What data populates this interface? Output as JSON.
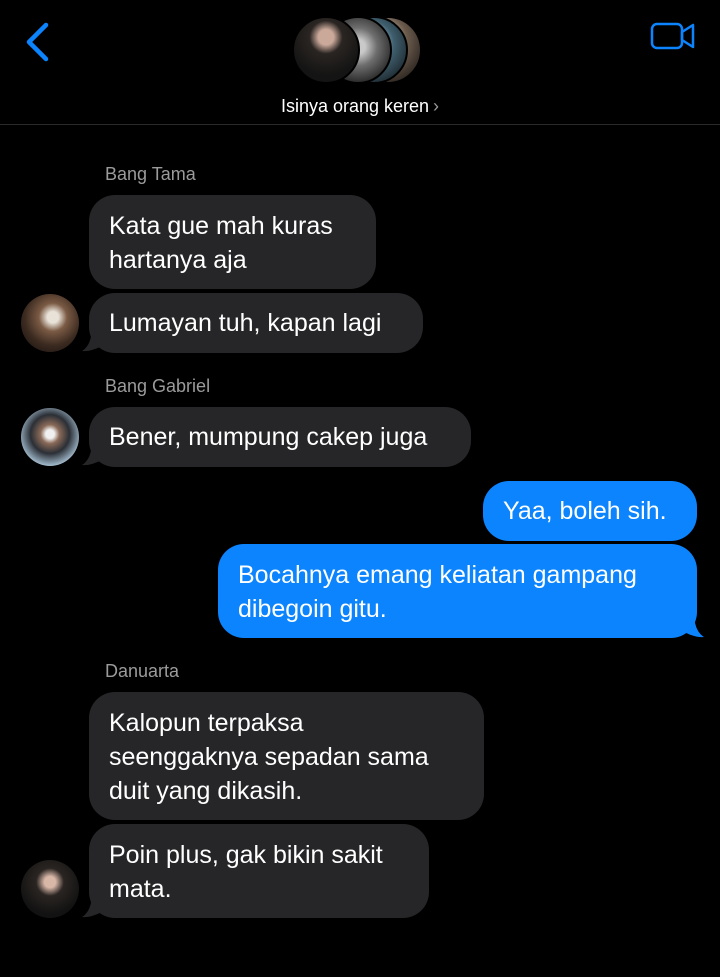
{
  "header": {
    "group_name": "Isinya orang keren",
    "chevron": "›",
    "back_icon": "chevron-left-icon",
    "video_icon": "video-camera-icon",
    "accent_color": "#0b84fe"
  },
  "messages": {
    "tama_name": "Bang Tama",
    "tama_1_line1": "Kata gue mah kuras",
    "tama_1_line2": "hartanya aja",
    "tama_2": "Lumayan tuh, kapan lagi",
    "gabriel_name": "Bang Gabriel",
    "gabriel_1": "Bener, mumpung cakep juga",
    "me_1": "Yaa, boleh sih.",
    "me_2_line1": "Bocahnya emang keliatan gampang",
    "me_2_line2": "dibegoin gitu.",
    "danu_name": "Danuarta",
    "danu_1_line1": "Kalopun terpaksa",
    "danu_1_line2": "seenggaknya sepadan sama",
    "danu_1_line3": "duit yang dikasih.",
    "danu_2_line1": "Poin plus, gak bikin sakit",
    "danu_2_line2": "mata."
  },
  "colors": {
    "incoming_bubble": "#262628",
    "outgoing_bubble": "#0b84fe",
    "sender_label": "#9b9b9b"
  }
}
